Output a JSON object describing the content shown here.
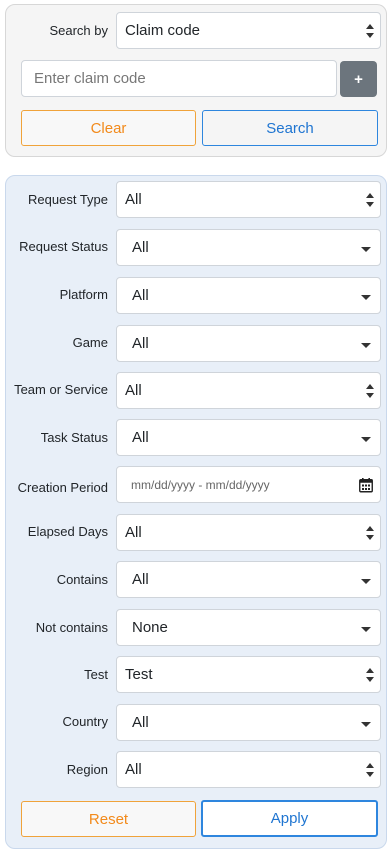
{
  "search": {
    "search_by_label": "Search by",
    "search_by_value": "Claim code",
    "input_placeholder": "Enter claim code",
    "plus_label": "+",
    "clear_label": "Clear",
    "search_label": "Search"
  },
  "filters": {
    "request_type": {
      "label": "Request Type",
      "value": "All"
    },
    "request_status": {
      "label": "Request Status",
      "value": "All"
    },
    "platform": {
      "label": "Platform",
      "value": "All"
    },
    "game": {
      "label": "Game",
      "value": "All"
    },
    "team_or_service": {
      "label": "Team or Service",
      "value": "All"
    },
    "task_status": {
      "label": "Task Status",
      "value": "All"
    },
    "creation_period": {
      "label": "Creation Period",
      "placeholder": "mm/dd/yyyy - mm/dd/yyyy"
    },
    "elapsed_days": {
      "label": "Elapsed Days",
      "value": "All"
    },
    "contains": {
      "label": "Contains",
      "value": "All"
    },
    "not_contains": {
      "label": "Not contains",
      "value": "None"
    },
    "test": {
      "label": "Test",
      "value": "Test"
    },
    "country": {
      "label": "Country",
      "value": "All"
    },
    "region": {
      "label": "Region",
      "value": "All"
    },
    "reset_label": "Reset",
    "apply_label": "Apply"
  },
  "colors": {
    "accent_orange": "#f28a1b",
    "accent_blue": "#1f75d1",
    "filters_bg": "#e8eff8",
    "search_bg": "#f5f5f5"
  }
}
